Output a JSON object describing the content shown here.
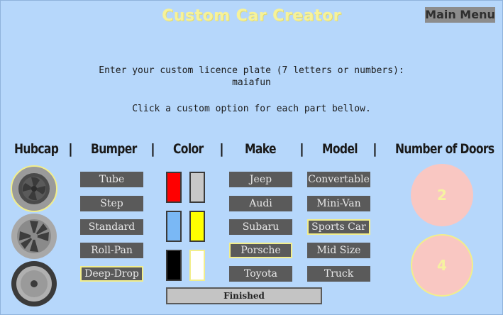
{
  "title": "Custom Car Creator",
  "main_menu_label": "Main Menu",
  "plate": {
    "prompt": "Enter your custom licence plate (7 letters or numbers):",
    "value": "maiafun"
  },
  "instruction": "Click a custom option for each part bellow.",
  "headers": {
    "hubcap": "Hubcap",
    "bumper": "Bumper",
    "color": "Color",
    "make": "Make",
    "model": "Model",
    "doors": "Number of Doors",
    "separator": "|"
  },
  "bumpers": [
    "Tube",
    "Step",
    "Standard",
    "Roll-Pan",
    "Deep-Drop"
  ],
  "makes": [
    "Jeep",
    "Audi",
    "Subaru",
    "Porsche",
    "Toyota"
  ],
  "models": [
    "Convertable",
    "Mini-Van",
    "Sports Car",
    "Mid Size",
    "Truck"
  ],
  "colors": [
    "#ff0000",
    "#c8c8c8",
    "#7ab8f5",
    "#ffff00",
    "#000000",
    "#ffffff"
  ],
  "hubcaps": [
    "spiral-hubcap-icon",
    "fan-hubcap-icon",
    "plain-hubcap-icon"
  ],
  "doors": [
    "2",
    "4"
  ],
  "selected": {
    "hubcap": "spiral-hubcap-icon",
    "bumper": "Deep-Drop",
    "make": "Porsche",
    "model": "Sports Car",
    "color": "#ffffff",
    "doors": "4"
  },
  "finished_label": "Finished"
}
